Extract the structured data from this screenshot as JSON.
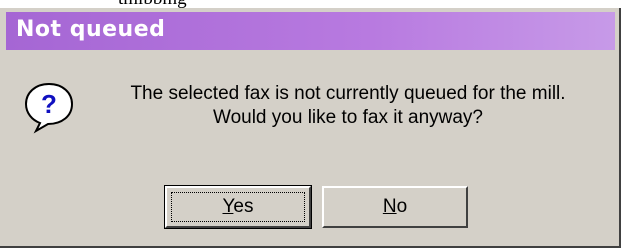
{
  "dialog": {
    "cut_text_above": "tmlbbmg",
    "title": "Not queued",
    "icon": "question-icon",
    "message_line1": "The selected fax is not currently queued for the mill.",
    "message_line2": "Would you like to fax it anyway?",
    "buttons": {
      "yes_label": "Yes",
      "no_label": "No"
    }
  },
  "colors": {
    "titlebar": "#a566d4",
    "face": "#d4d0c8"
  }
}
